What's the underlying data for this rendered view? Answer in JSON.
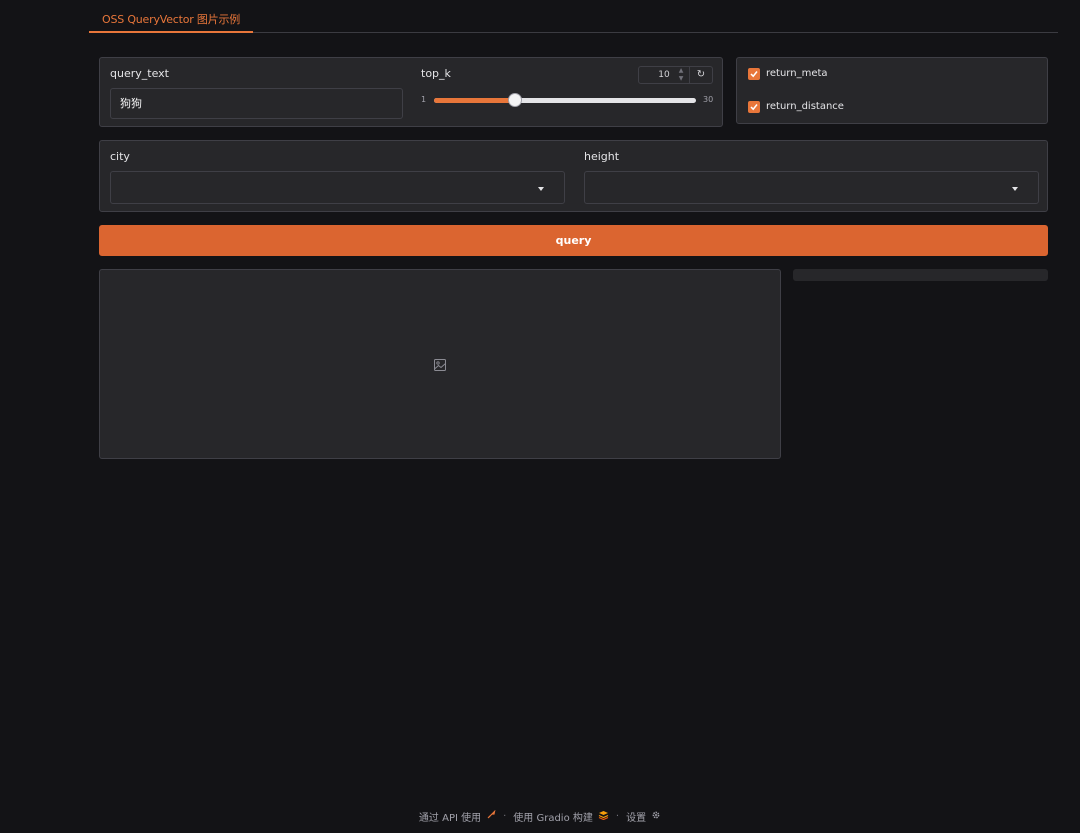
{
  "tabs": [
    {
      "label": "OSS QueryVector 图片示例"
    }
  ],
  "query_text": {
    "label": "query_text",
    "value": "狗狗"
  },
  "top_k": {
    "label": "top_k",
    "value": "10",
    "min": "1",
    "max": "30",
    "fraction": 0.31,
    "reset_icon": "reset-icon"
  },
  "checkboxes": [
    {
      "label": "return_meta",
      "checked": true
    },
    {
      "label": "return_distance",
      "checked": true
    }
  ],
  "city": {
    "label": "city",
    "value": ""
  },
  "height": {
    "label": "height",
    "value": ""
  },
  "query_button": {
    "label": "query"
  },
  "image_output": {
    "icon": "image-icon"
  },
  "footer": {
    "api_text": "通过 API 使用",
    "built_text": "使用 Gradio 构建",
    "settings_text": "设置",
    "separator": "·"
  },
  "colors": {
    "accent": "#e8763a",
    "button": "#db6530",
    "background": "#131316",
    "panel": "#27272a"
  }
}
